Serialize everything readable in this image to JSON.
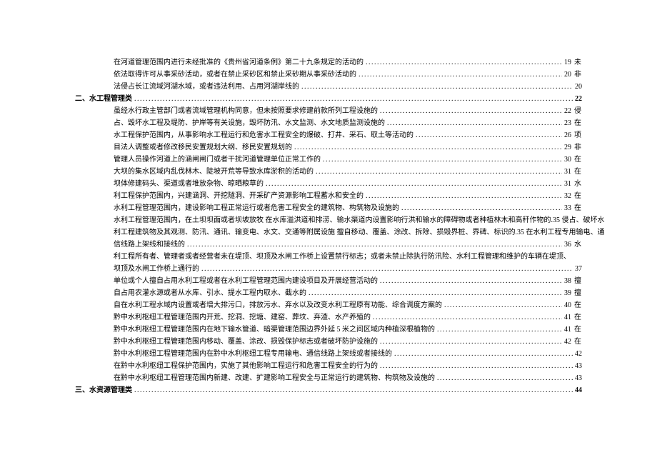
{
  "lines": [
    {
      "indent": true,
      "section": false,
      "text": "在河道管理范围内进行未经批准的《贵州省河道条例》第二十九条规定的活动的",
      "page": "19",
      "suffix": "未"
    },
    {
      "indent": true,
      "section": false,
      "text": "依法取得许可从事采砂活动，或者在禁止采砂区和禁止采砂期从事采砂活动的",
      "page": "20",
      "suffix": "非"
    },
    {
      "indent": true,
      "section": false,
      "text": "法侵占长江流域河湖水域，或者违法利用、占用河湖岸线的",
      "page": "20",
      "suffix": ""
    },
    {
      "indent": false,
      "section": true,
      "text": "二、水工程管理类",
      "page": "22",
      "suffix": ""
    },
    {
      "indent": true,
      "section": false,
      "text": "虽经水行政主管部门或者流域管理机构同意，但未按照要求修建前款所列工程设施的",
      "page": "22",
      "suffix": "侵"
    },
    {
      "indent": true,
      "section": false,
      "text": "占、毁坏水工程及堤防、护岸等有关设施，毁坏防汛、水文监测、水文地质监测设施的",
      "page": "23",
      "suffix": "在"
    },
    {
      "indent": true,
      "section": false,
      "text": "水工程保护范围内，从事影响水工程运行和危害水工程安全的爆破、打井、采石、取土等活动的",
      "page": "26",
      "suffix": "项"
    },
    {
      "indent": true,
      "section": false,
      "text": "目法人调整或者修改移民安置规划大纲、移民安置规划的",
      "page": "29",
      "suffix": "非"
    },
    {
      "indent": true,
      "section": false,
      "text": "管理人员操作河道上的涵闸闸门或者干扰河道管理单位正常工作的",
      "page": "30",
      "suffix": "在"
    },
    {
      "indent": true,
      "section": false,
      "text": "大坝的集水区域内乱伐林木、陡坡开荒等导致水库淤积的活动的",
      "page": "31",
      "suffix": "在"
    },
    {
      "indent": true,
      "section": false,
      "text": "坝体修建码头、渠道或者堆放杂物、晾晒粮草的",
      "page": "31",
      "suffix": "水"
    },
    {
      "indent": true,
      "section": false,
      "text": "利工程保护范围内，兴建涵洞、开挖隧洞、开采矿产资源影响工程蓄水和安全的",
      "page": "32",
      "suffix": "在"
    },
    {
      "indent": true,
      "section": false,
      "text": "水利工程管理范围内，建设影响工程正常运行或者危害工程安全的建筑物、构筑物及设施的",
      "page": "33",
      "suffix": "在"
    },
    {
      "indent": true,
      "section": false,
      "text": "水利工程管理范围内，在土坝坝面或者坝坡放牧 在水库溢洪道和排涝、输水渠道内设置影响行洪和输水的障碍物或者种植林木和高秆作物的.35 侵占、破坏水",
      "page": null,
      "suffix": ""
    },
    {
      "indent": true,
      "section": false,
      "text": "利工程建筑物及其观测、防汛、通讯、输变电、水文、交通等附属设施 擅自移动、覆盖、涂改、拆除、损毁界桩、界碑、标识的.35 在水利工程专用输电、通",
      "page": null,
      "suffix": ""
    },
    {
      "indent": true,
      "section": false,
      "text": "信线路上架线和接线的",
      "page": "36",
      "suffix": "水"
    },
    {
      "indent": true,
      "section": false,
      "text": "利工程所有者、管理者或者经营者未在堤顶、坝顶及水闸工作桥上设置禁行标志；或者未禁止除执行防汛险、水利工程管理和维护的车辆在堤顶、",
      "page": null,
      "suffix": ""
    },
    {
      "indent": true,
      "section": false,
      "text": "坝顶及水闸工作桥上通行的",
      "page": "37",
      "suffix": ""
    },
    {
      "indent": true,
      "section": false,
      "text": "单位或个人擅自占用水利工程或者在水利工程管理范围内建设项目及开展经营活动的",
      "page": "38",
      "suffix": "擅"
    },
    {
      "indent": true,
      "section": false,
      "text": "自占用农灌水源或者从水库、引水、提水工程内取水、截水的",
      "page": "39",
      "suffix": "擅"
    },
    {
      "indent": true,
      "section": false,
      "text": "自在水利工程水域内设置或者增大排污口，排放污水、弃水以及改变水利工程原有功能、综合调度方案的",
      "page": "40",
      "suffix": "在"
    },
    {
      "indent": true,
      "section": false,
      "text": "黔中水利枢纽工程管理范围内开荒、挖洞、挖塘、建窑、葬坟、弃渣、水产养殖的",
      "page": "41",
      "suffix": "在"
    },
    {
      "indent": true,
      "section": false,
      "text": "黔中水利枢纽工程管理范围内在地下输水管道、暗渠管理范围边界外延 5 米之间区域内种植深根植物的",
      "page": "41",
      "suffix": "在"
    },
    {
      "indent": true,
      "section": false,
      "text": "黔中水利枢纽工程管理范围内移动、覆盖、涂改、损毁保护标志或者破坏防护设施的",
      "page": "42",
      "suffix": "在"
    },
    {
      "indent": true,
      "section": false,
      "text": "黔中水利枢纽工程管理范围内在黔中水利枢纽工程专用输电、通信线路上架线或者接线的",
      "page": "42",
      "suffix": ""
    },
    {
      "indent": true,
      "section": false,
      "text": "在黔中水利枢纽工程保护范围内，实施了其他影响工程运行和危害工程安全的行为的",
      "page": "43",
      "suffix": ""
    },
    {
      "indent": true,
      "section": false,
      "text": "在黔中水利枢纽工程管理范围内新建、改建、扩建影响工程安全与正常运行的建筑物、构筑物及设施的",
      "page": "43",
      "suffix": ""
    },
    {
      "indent": false,
      "section": true,
      "text": "三、水资源管理类",
      "page": "44",
      "suffix": ""
    }
  ]
}
